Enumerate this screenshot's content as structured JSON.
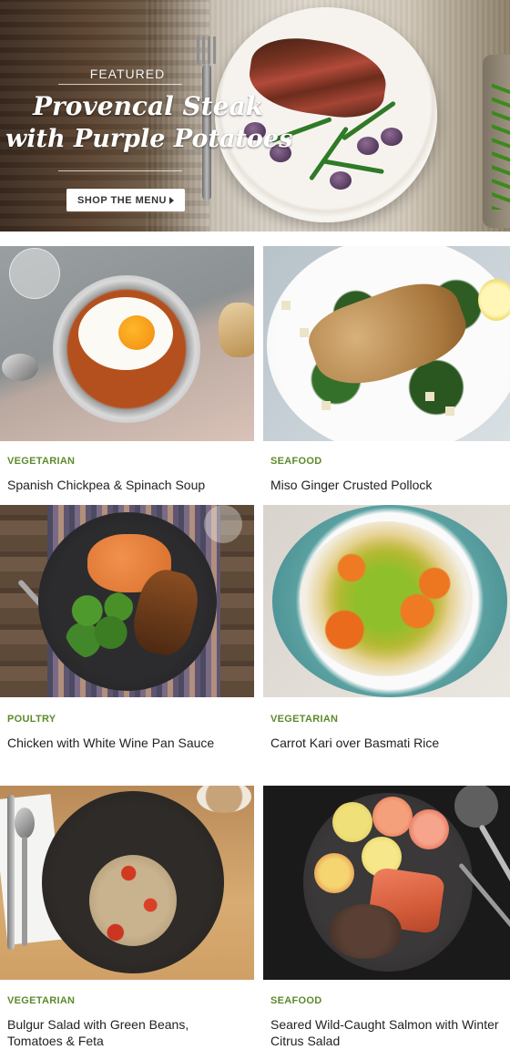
{
  "hero": {
    "eyebrow": "FEATURED",
    "title_line1": "Provencal Steak",
    "title_line2": "with Purple Potatoes",
    "button_label": "SHOP THE MENU"
  },
  "recipes": [
    {
      "category": "VEGETARIAN",
      "name": "Spanish Chickpea & Spinach Soup"
    },
    {
      "category": "SEAFOOD",
      "name": "Miso Ginger Crusted Pollock"
    },
    {
      "category": "POULTRY",
      "name": "Chicken with White Wine Pan Sauce"
    },
    {
      "category": "VEGETARIAN",
      "name": "Carrot Kari over Basmati Rice"
    },
    {
      "category": "VEGETARIAN",
      "name_line1": "Bulgur Salad with Green Beans,",
      "name_line2": "Tomatoes & Feta"
    },
    {
      "category": "SEAFOOD",
      "name_line1": "Seared Wild-Caught Salmon with Winter",
      "name_line2": "Citrus Salad"
    }
  ],
  "colors": {
    "category": "#5d8a2b",
    "title": "#222222"
  }
}
